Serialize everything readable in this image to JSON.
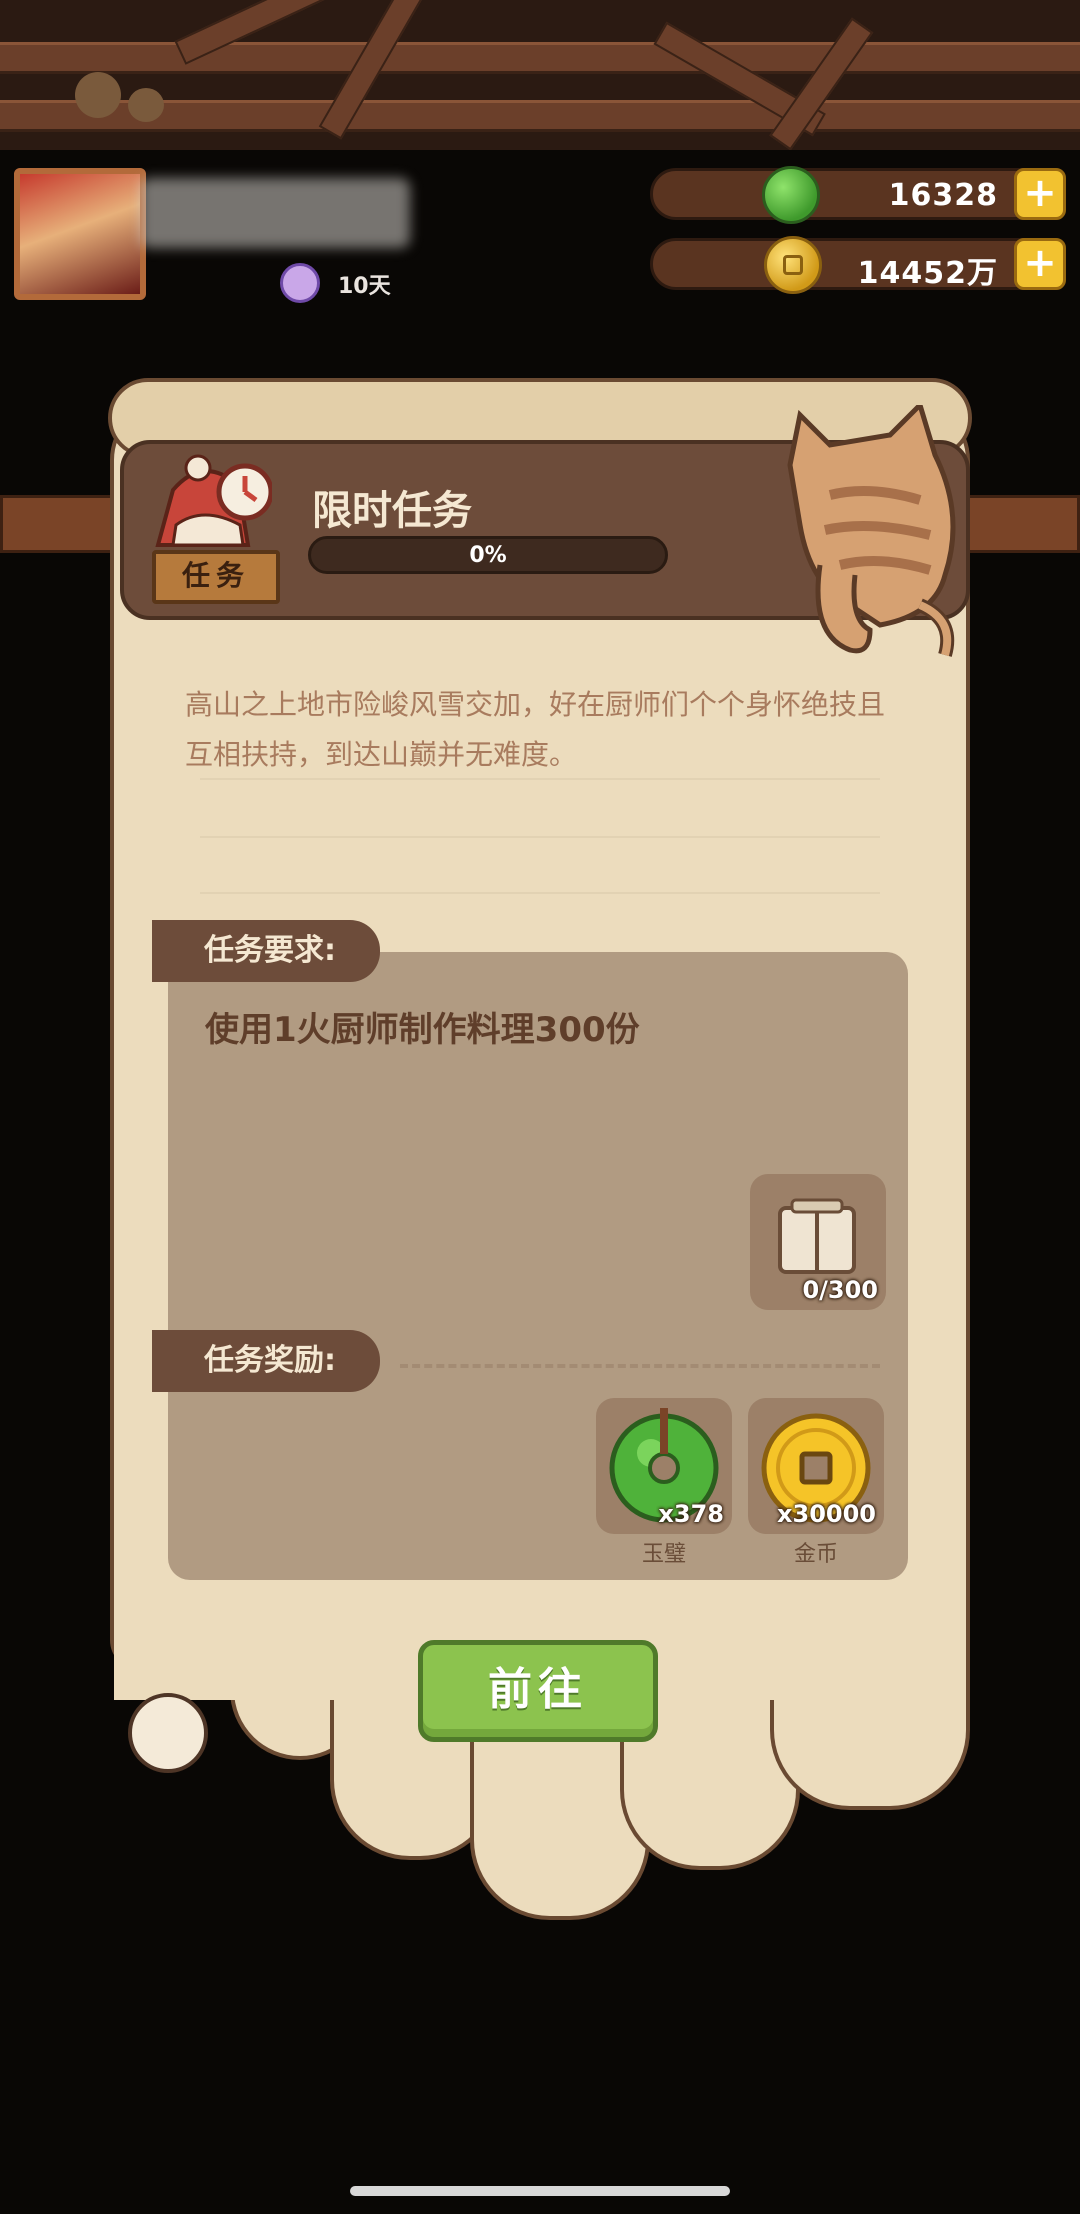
{
  "player": {
    "days": "10天"
  },
  "currency": {
    "jade": "16328",
    "gold": "14452万"
  },
  "task": {
    "badge": "任务",
    "title": "限时任务",
    "progress_percent": 0,
    "progress_text": "0%",
    "description": "高山之上地市险峻风雪交加，好在厨师们个个身怀绝技且互相扶持，到达山巅并无难度。",
    "requirement_label": "任务要求:",
    "requirement_text": "使用1火厨师制作料理300份",
    "requirement_item": {
      "icon": "stack-of-plates-icon",
      "count": "0/300"
    },
    "reward_label": "任务奖励:",
    "rewards": [
      {
        "icon": "jade-disc-icon",
        "count": "x378",
        "name": "玉璧"
      },
      {
        "icon": "gold-coin-icon",
        "count": "x30000",
        "name": "金币"
      }
    ],
    "go_button": "前往"
  },
  "colors": {
    "parchment": "#ecdcbd",
    "board": "#6d4c3a",
    "button_green": "#8cc34e",
    "text_brown": "#a87b5e"
  }
}
